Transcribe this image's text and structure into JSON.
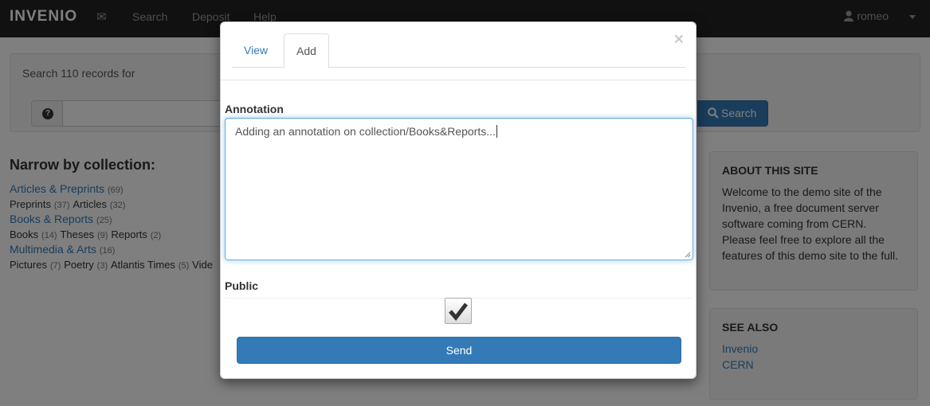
{
  "navbar": {
    "brand": "INVENIO",
    "links": [
      "Search",
      "Deposit",
      "Help"
    ],
    "user": "romeo"
  },
  "search": {
    "label": "Search 110 records for",
    "help": "?",
    "button": "Search"
  },
  "collections": {
    "title": "Narrow by collection:",
    "groups": [
      {
        "name": "Articles & Preprints",
        "count": "(69)",
        "subs": [
          {
            "name": "Preprints",
            "count": "(37)"
          },
          {
            "name": "Articles",
            "count": "(32)"
          }
        ]
      },
      {
        "name": "Books & Reports",
        "count": "(25)",
        "subs": [
          {
            "name": "Books",
            "count": "(14)"
          },
          {
            "name": "Theses",
            "count": "(9)"
          },
          {
            "name": "Reports",
            "count": "(2)"
          }
        ]
      },
      {
        "name": "Multimedia & Arts",
        "count": "(16)",
        "subs": [
          {
            "name": "Pictures",
            "count": "(7)"
          },
          {
            "name": "Poetry",
            "count": "(3)"
          },
          {
            "name": "Atlantis Times",
            "count": "(5)"
          },
          {
            "name": "Vide"
          }
        ]
      }
    ]
  },
  "about": {
    "title": "ABOUT THIS SITE",
    "lines": [
      "Welcome to the demo site of the",
      "Invenio, a free document server",
      "software coming from CERN.",
      "Please feel free to explore all the",
      "features of this demo site to the full."
    ]
  },
  "see_also": {
    "title": "SEE ALSO",
    "links": [
      "Invenio",
      "CERN"
    ]
  },
  "modal": {
    "close": "×",
    "tabs": [
      "View",
      "Add"
    ],
    "annotation_label": "Annotation",
    "annotation_value": "Adding an annotation on collection/Books&Reports...",
    "public_label": "Public",
    "public_checked": true,
    "send": "Send"
  },
  "colors": {
    "primary": "#337ab7",
    "navbar": "#222222"
  }
}
